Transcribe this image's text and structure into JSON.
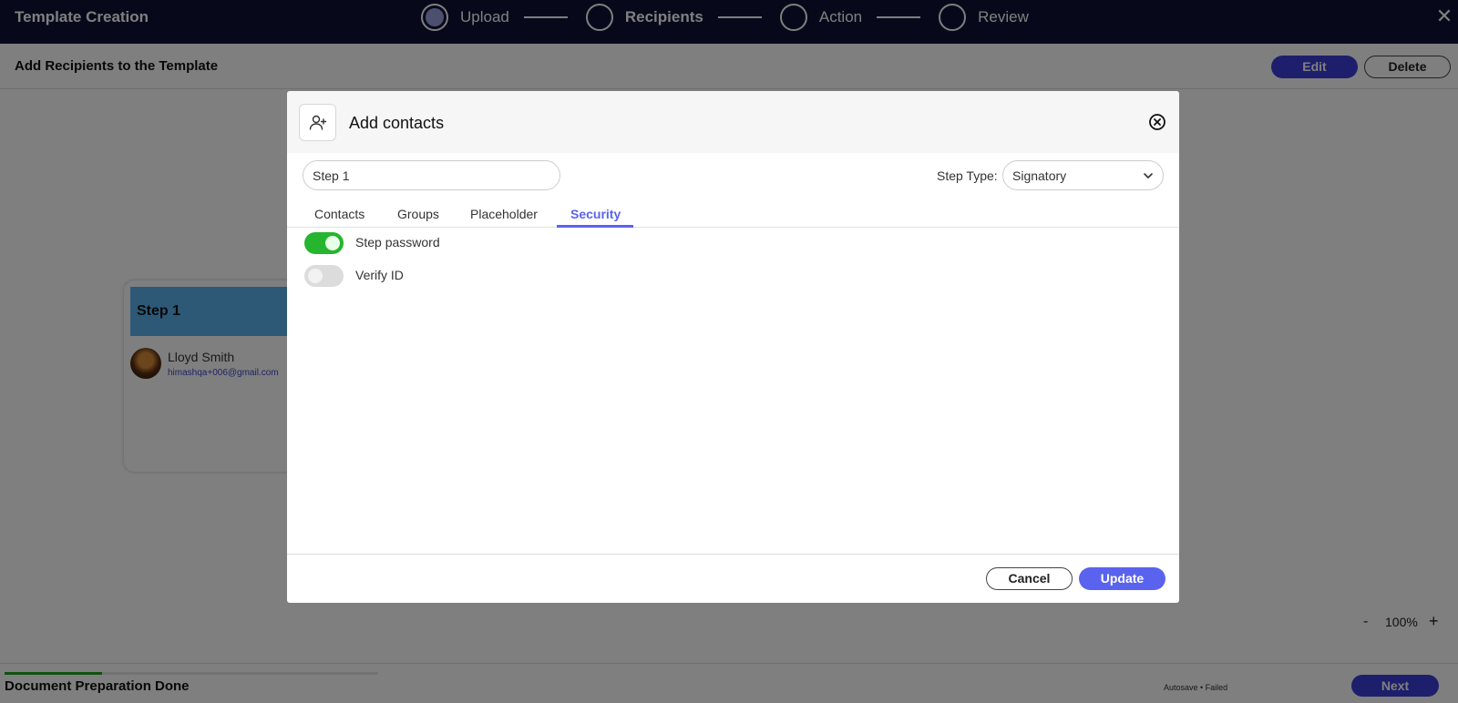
{
  "header": {
    "title": "Template Creation",
    "steps": [
      {
        "label": "Upload",
        "state": "done"
      },
      {
        "label": "Recipients",
        "state": "active"
      },
      {
        "label": "Action",
        "state": "pending"
      },
      {
        "label": "Review",
        "state": "pending"
      }
    ],
    "close_icon": "close-icon"
  },
  "subheader": {
    "title": "Add Recipients to the Template",
    "edit_label": "Edit",
    "delete_label": "Delete"
  },
  "canvas": {
    "step_card": {
      "title": "Step 1",
      "contact_name": "Lloyd Smith",
      "contact_email": "himashqa+006@gmail.com"
    },
    "zoom": {
      "minus": "-",
      "value": "100%",
      "plus": "+"
    }
  },
  "footer": {
    "status": "Document Preparation Done",
    "progress": 0.26,
    "autosave": "Autosave • Failed",
    "next_label": "Next"
  },
  "modal": {
    "title": "Add contacts",
    "icon": "add-user-icon",
    "close_icon": "close-circle-icon",
    "step_name_value": "Step 1",
    "step_type_label": "Step Type:",
    "step_type_value": "Signatory",
    "tabs": [
      {
        "label": "Contacts",
        "active": false
      },
      {
        "label": "Groups",
        "active": false
      },
      {
        "label": "Placeholder",
        "active": false
      },
      {
        "label": "Security",
        "active": true
      }
    ],
    "security": [
      {
        "label": "Step password",
        "enabled": true
      },
      {
        "label": "Verify ID",
        "enabled": false
      }
    ],
    "cancel_label": "Cancel",
    "update_label": "Update"
  },
  "colors": {
    "header_bg": "#0f1337",
    "accent": "#5a63ee",
    "primary_button": "#3a3fd8",
    "toggle_on": "#26b52e",
    "step_card_head": "#5bb3ee",
    "progress": "#22a322"
  }
}
